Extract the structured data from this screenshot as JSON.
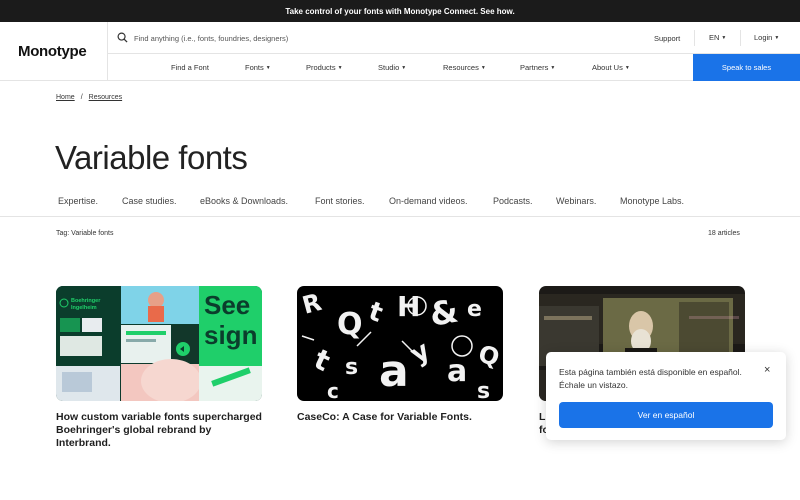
{
  "announcement": "Take control of your fonts with Monotype Connect. See how.",
  "header": {
    "logo": "Monotype",
    "search_placeholder": "Find anything (i.e., fonts, foundries, designers)",
    "support": "Support",
    "language": "EN",
    "login": "Login",
    "nav": [
      "Find a Font",
      "Fonts",
      "Products",
      "Studio",
      "Resources",
      "Partners",
      "About Us"
    ],
    "cta": "Speak to sales"
  },
  "breadcrumb": {
    "home": "Home",
    "separator": "/",
    "current": "Resources"
  },
  "page_title": "Variable fonts",
  "categories": [
    "Expertise.",
    "Case studies.",
    "eBooks & Downloads.",
    "Font stories.",
    "On-demand videos.",
    "Podcasts.",
    "Webinars.",
    "Monotype Labs."
  ],
  "tag_label": "Tag: Variable fonts",
  "article_count": "18 articles",
  "cards": [
    {
      "title": "How custom variable fonts supercharged Boehringer's global rebrand by Interbrand.",
      "img_text_1": "Boehringer Ingelheim",
      "img_text_2": "See",
      "img_text_3": "sign"
    },
    {
      "title": "CaseCo: A Case for Variable Fonts."
    },
    {
      "title_visible": "L\nfo"
    }
  ],
  "popup": {
    "message": "Esta página también está disponible en español. Échale un vistazo.",
    "button": "Ver en español",
    "close": "×"
  },
  "colors": {
    "accent": "#1a73e8",
    "announce_bg": "#1b1b1b",
    "brand_green": "#1fcf6a",
    "dark_green": "#0b3d2c"
  }
}
